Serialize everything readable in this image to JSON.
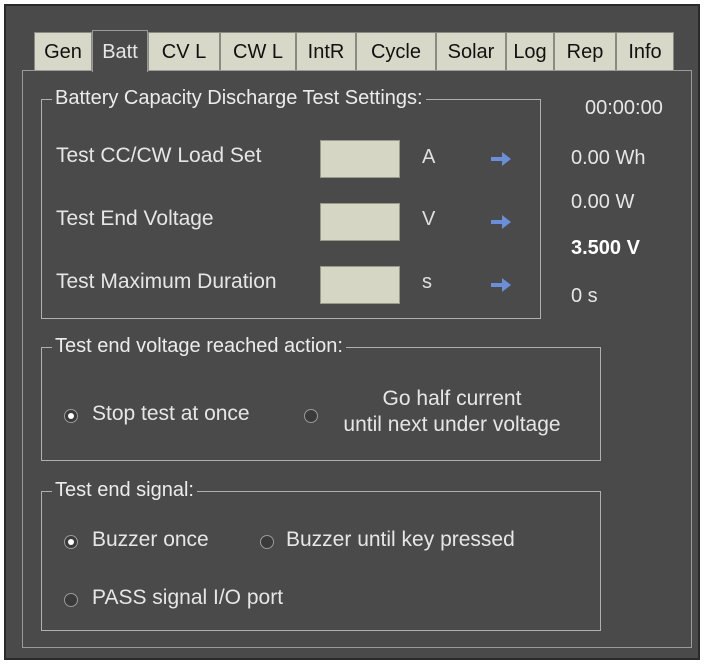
{
  "tabs": [
    "Gen",
    "Batt",
    "CV L",
    "CW L",
    "IntR",
    "Cycle",
    "Solar",
    "Log",
    "Rep",
    "Info"
  ],
  "active_tab": "Batt",
  "settings_group": {
    "title": "Battery Capacity Discharge Test Settings:",
    "load_set": {
      "label": "Test CC/CW Load Set",
      "value": "",
      "unit": "A"
    },
    "end_voltage": {
      "label": "Test End Voltage",
      "value": "",
      "unit": "V"
    },
    "max_duration": {
      "label": "Test Maximum Duration",
      "value": "",
      "unit": "s"
    },
    "arrow_icon": "arrow-right-icon",
    "arrow_color": "#6a8fd8"
  },
  "readouts": {
    "time": "00:00:00",
    "energy": "0.00 Wh",
    "power": "0.00 W",
    "voltage": "3.500 V",
    "elapsed": "0 s"
  },
  "action_group": {
    "title": "Test end voltage reached action:",
    "option_stop": "Stop test at once",
    "option_half_line1": "Go half current",
    "option_half_line2": "until next under voltage",
    "selected": "stop"
  },
  "signal_group": {
    "title": "Test end signal:",
    "option_buzzer_once": "Buzzer once",
    "option_buzzer_until": "Buzzer until key pressed",
    "option_pass_signal": "PASS signal I/O port",
    "selected": "buzzer_once"
  },
  "colors": {
    "background": "#4a4a4a",
    "tab_inactive": "#d8d8c8",
    "input_bg": "#d6d6c4"
  }
}
